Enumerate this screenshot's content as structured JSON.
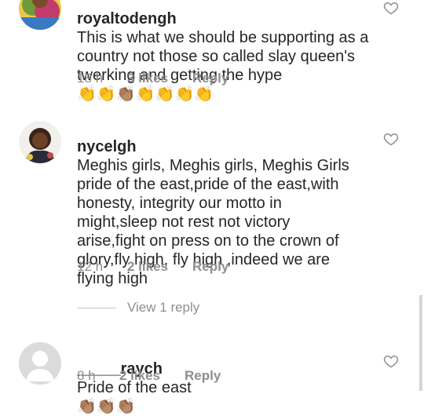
{
  "comments": [
    {
      "username": "royaltodengh",
      "text": "This is what we should be supporting as a country not those so called slay queen's twerking and getting the hype",
      "emoji": "👏👏👏🏽👏👏👏👏",
      "time": "18 h",
      "likes": "3 likes",
      "reply": "Reply"
    },
    {
      "username": "nycelgh",
      "text": "Meghis girls, Meghis girls, Meghis Girls pride of the east,pride of the east,with honesty, integrity our motto in might,sleep not rest not victory arise,fight on press on to the crown of glory,fly high, fly high ,indeed we are flying high",
      "time": "12 h",
      "likes": "2 likes",
      "reply": "Reply"
    },
    {
      "username": "_____raych",
      "text": "Pride of the east",
      "emoji": "👏🏽👏🏽👏🏽",
      "time": "8 h",
      "likes": "2 likes",
      "reply": "Reply"
    }
  ],
  "view_replies": "View 1 reply",
  "icons": {
    "like": "heart-outline-icon",
    "default_avatar": "default-avatar-icon"
  },
  "colors": {
    "text": "#262626",
    "meta": "#8e8e8e",
    "heart": "#8e8e8e"
  }
}
